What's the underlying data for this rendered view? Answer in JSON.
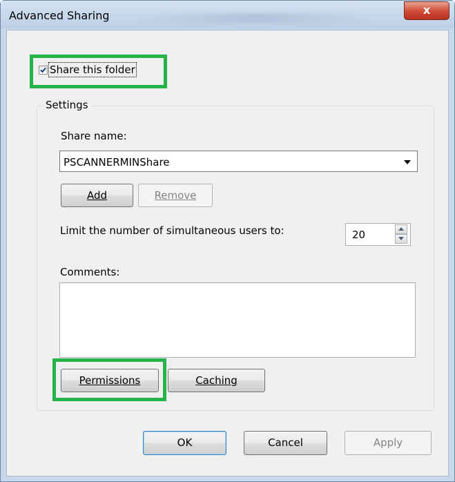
{
  "window": {
    "title": "Advanced Sharing",
    "close_label": "x"
  },
  "share_folder": {
    "label": "Share this folder",
    "checked": true
  },
  "settings": {
    "group_label": "Settings",
    "share_name_label": "Share name:",
    "share_name_value": "PSCANNERMINShare",
    "add_label": "Add",
    "remove_label": "Remove",
    "limit_label": "Limit the number of simultaneous users to:",
    "limit_value": "20",
    "comments_label": "Comments:",
    "comments_value": "",
    "permissions_label": "Permissions",
    "caching_label": "Caching"
  },
  "footer": {
    "ok_label": "OK",
    "cancel_label": "Cancel",
    "apply_label": "Apply"
  },
  "colors": {
    "highlight": "#27b24a",
    "close_button": "#cf4a35",
    "window_frame": "#c7d8ec"
  }
}
